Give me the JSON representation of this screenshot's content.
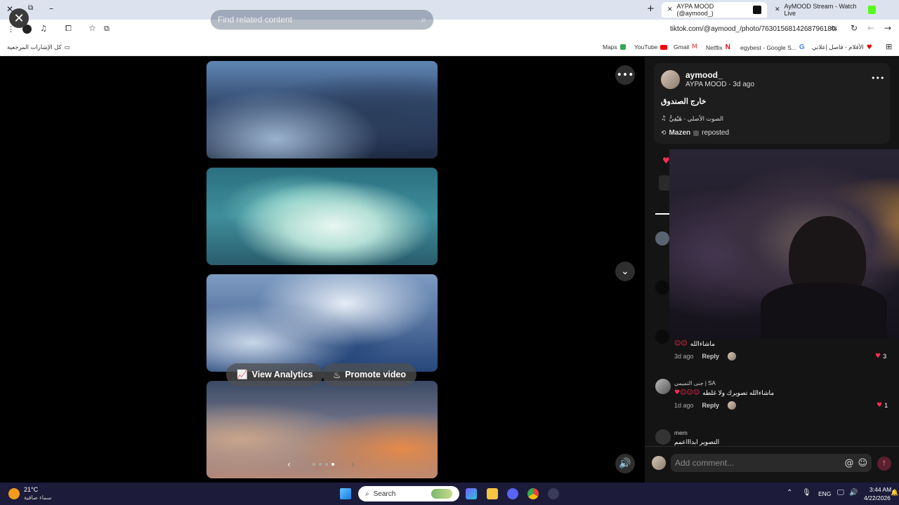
{
  "browser": {
    "tabs": [
      {
        "title": "AYPA MOOD (@aymood_)",
        "active": true
      },
      {
        "title": "AyMOOD Stream - Watch Live",
        "active": false
      }
    ],
    "new_tab_icon": "plus-icon",
    "url": "tiktok.com/@aymood_/photo/7630156814268796180",
    "bookmarks": [
      {
        "label": "Maps"
      },
      {
        "label": "YouTube"
      },
      {
        "label": "Gmail"
      },
      {
        "label": "Netflix"
      },
      {
        "label": "egybest - Google S..."
      },
      {
        "label": "الأفلام - فاصل إعلاني"
      }
    ],
    "all_bookmarks_label": "كل الإشارات المرجعية"
  },
  "viewer": {
    "search_placeholder": "Find related content",
    "view_analytics": "View Analytics",
    "promote_video": "Promote video",
    "carousel_dots": 4,
    "carousel_active": 3
  },
  "post": {
    "username": "aymood_",
    "display_name": "AYPA MOOD",
    "time": "3d ago",
    "caption": "خارج الصندوق",
    "sound": "الصوت الأصلي - هَيْفِيٌّ",
    "reposted_by": "Mazen",
    "reposted_label": "reposted"
  },
  "comments": [
    {
      "text": "ماشاءالله",
      "time": "3d ago",
      "reply": "Reply",
      "likes": "3"
    },
    {
      "author": "جنى التميمي | SA",
      "text": "ماشاءالله تصويرك ولا غلطه",
      "time": "1d ago",
      "reply": "Reply",
      "likes": "1"
    },
    {
      "author": "mem",
      "text": "التصوير ابداااعمم"
    }
  ],
  "comment_input": {
    "placeholder": "Add comment..."
  },
  "taskbar": {
    "weather_temp": "21°C",
    "weather_desc": "سماء صافية",
    "search_label": "Search",
    "language": "ENG",
    "time": "3:44 AM",
    "date": "4/22/2026"
  }
}
